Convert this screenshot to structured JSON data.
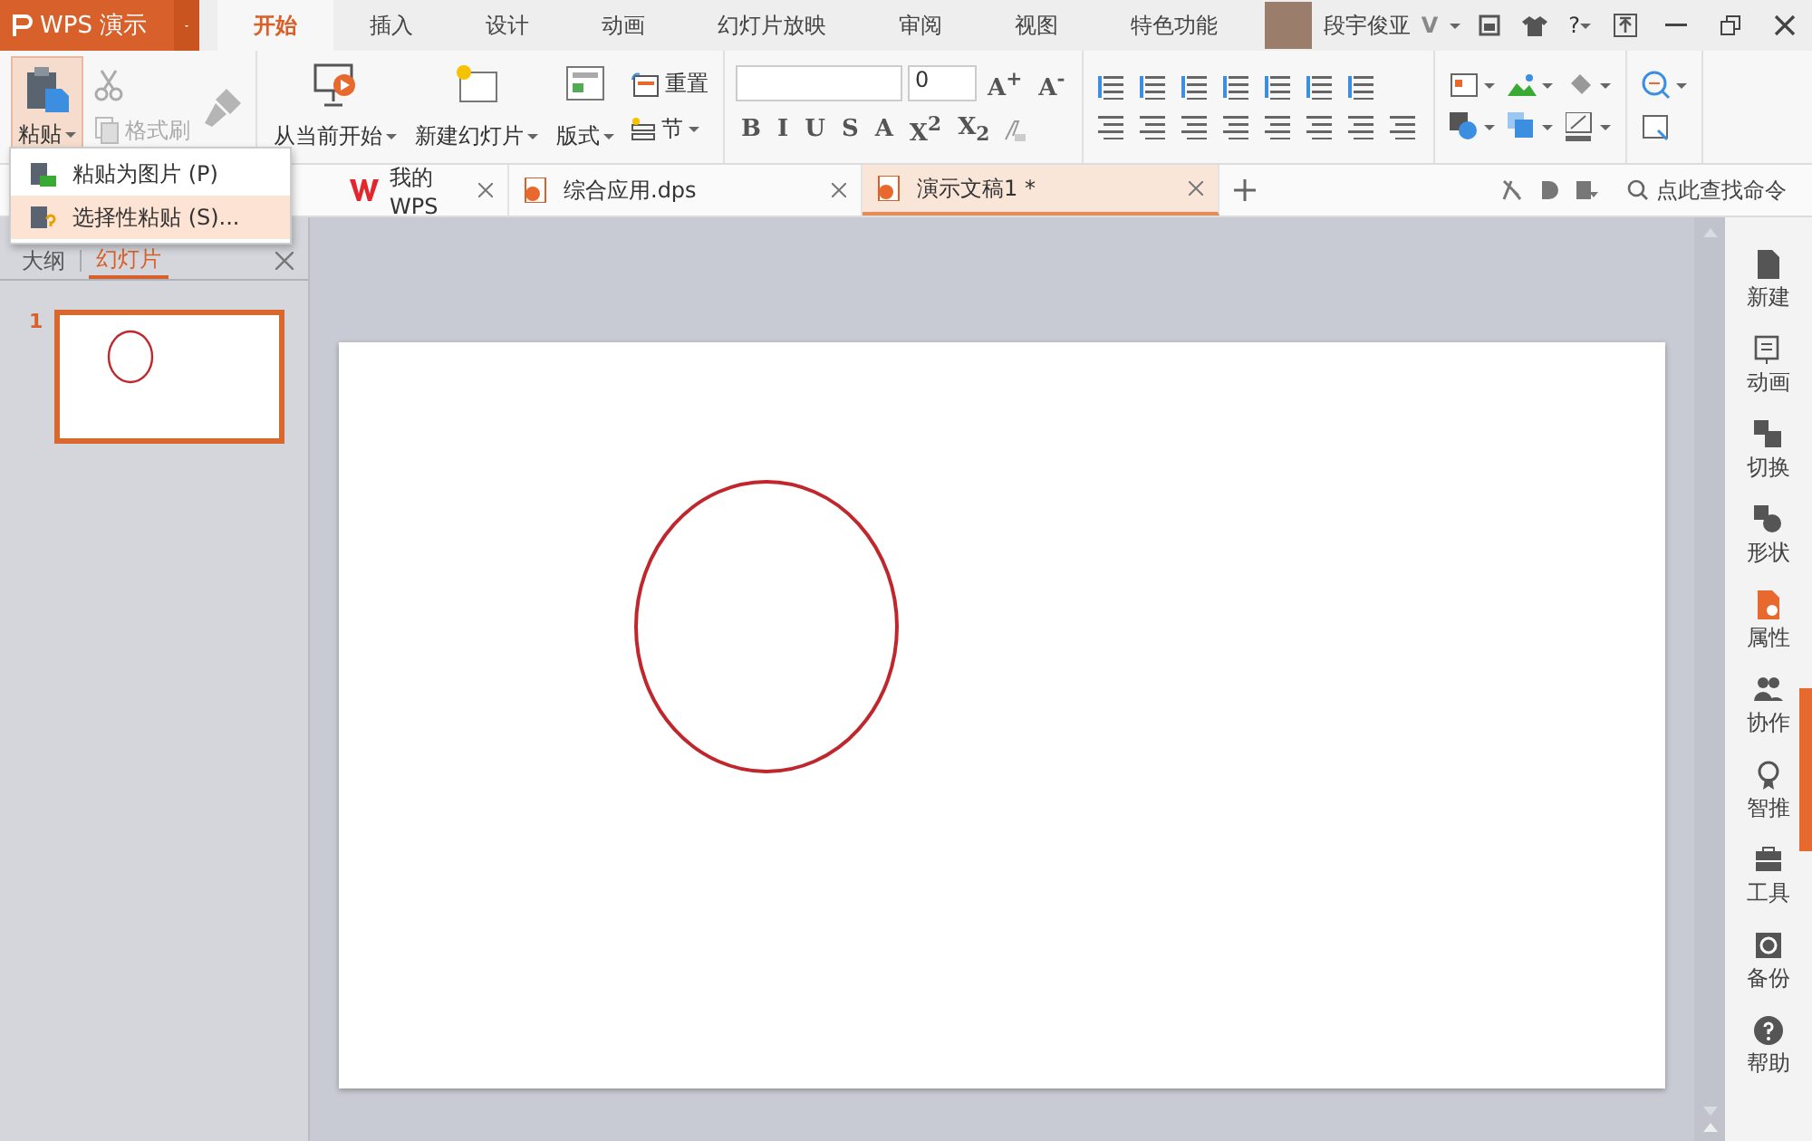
{
  "app": {
    "name": "WPS 演示"
  },
  "ribbon_tabs": [
    {
      "label": "开始",
      "selected": true
    },
    {
      "label": "插入",
      "selected": false
    },
    {
      "label": "设计",
      "selected": false
    },
    {
      "label": "动画",
      "selected": false
    },
    {
      "label": "幻灯片放映",
      "selected": false
    },
    {
      "label": "审阅",
      "selected": false
    },
    {
      "label": "视图",
      "selected": false
    },
    {
      "label": "特色功能",
      "selected": false
    }
  ],
  "user": {
    "name": "段宇俊亚",
    "badge": "V",
    "help": "?"
  },
  "ribbon": {
    "paste": "粘贴",
    "format_painter": "格式刷",
    "from_current": "从当前开始",
    "new_slide": "新建幻灯片",
    "layout": "版式",
    "reset": "重置",
    "section": "节",
    "font_size": "0",
    "grow": "A$^{+}$",
    "shrink": "A$^{-}$",
    "format_buttons": [
      "B",
      "I",
      "U",
      "S",
      "A",
      "X$^{2}$",
      "X$_{2}$"
    ]
  },
  "paste_menu": [
    {
      "label": "粘贴为图片 (P)",
      "selected": false
    },
    {
      "label": "选择性粘贴 (S)...",
      "selected": true
    }
  ],
  "doc_tabs": [
    {
      "label": "我的WPS",
      "kind": "home",
      "selected": false
    },
    {
      "label": "综合应用.dps",
      "kind": "file",
      "selected": false
    },
    {
      "label": "演示文稿1 *",
      "kind": "file",
      "selected": true
    }
  ],
  "command_search": {
    "placeholder": "点此查找命令"
  },
  "panel": {
    "tabs": [
      {
        "label": "大纲",
        "selected": false
      },
      {
        "label": "幻灯片",
        "selected": true
      }
    ],
    "slides": [
      {
        "number": "1",
        "selected": true
      }
    ]
  },
  "sidebar": [
    {
      "label": "新建",
      "selected": false
    },
    {
      "label": "动画",
      "selected": false
    },
    {
      "label": "切换",
      "selected": false
    },
    {
      "label": "形状",
      "selected": false
    },
    {
      "label": "属性",
      "selected": true
    },
    {
      "label": "协作",
      "selected": false
    },
    {
      "label": "智推",
      "selected": false
    },
    {
      "label": "工具",
      "selected": false
    },
    {
      "label": "备份",
      "selected": false
    },
    {
      "label": "帮助",
      "selected": false
    }
  ]
}
